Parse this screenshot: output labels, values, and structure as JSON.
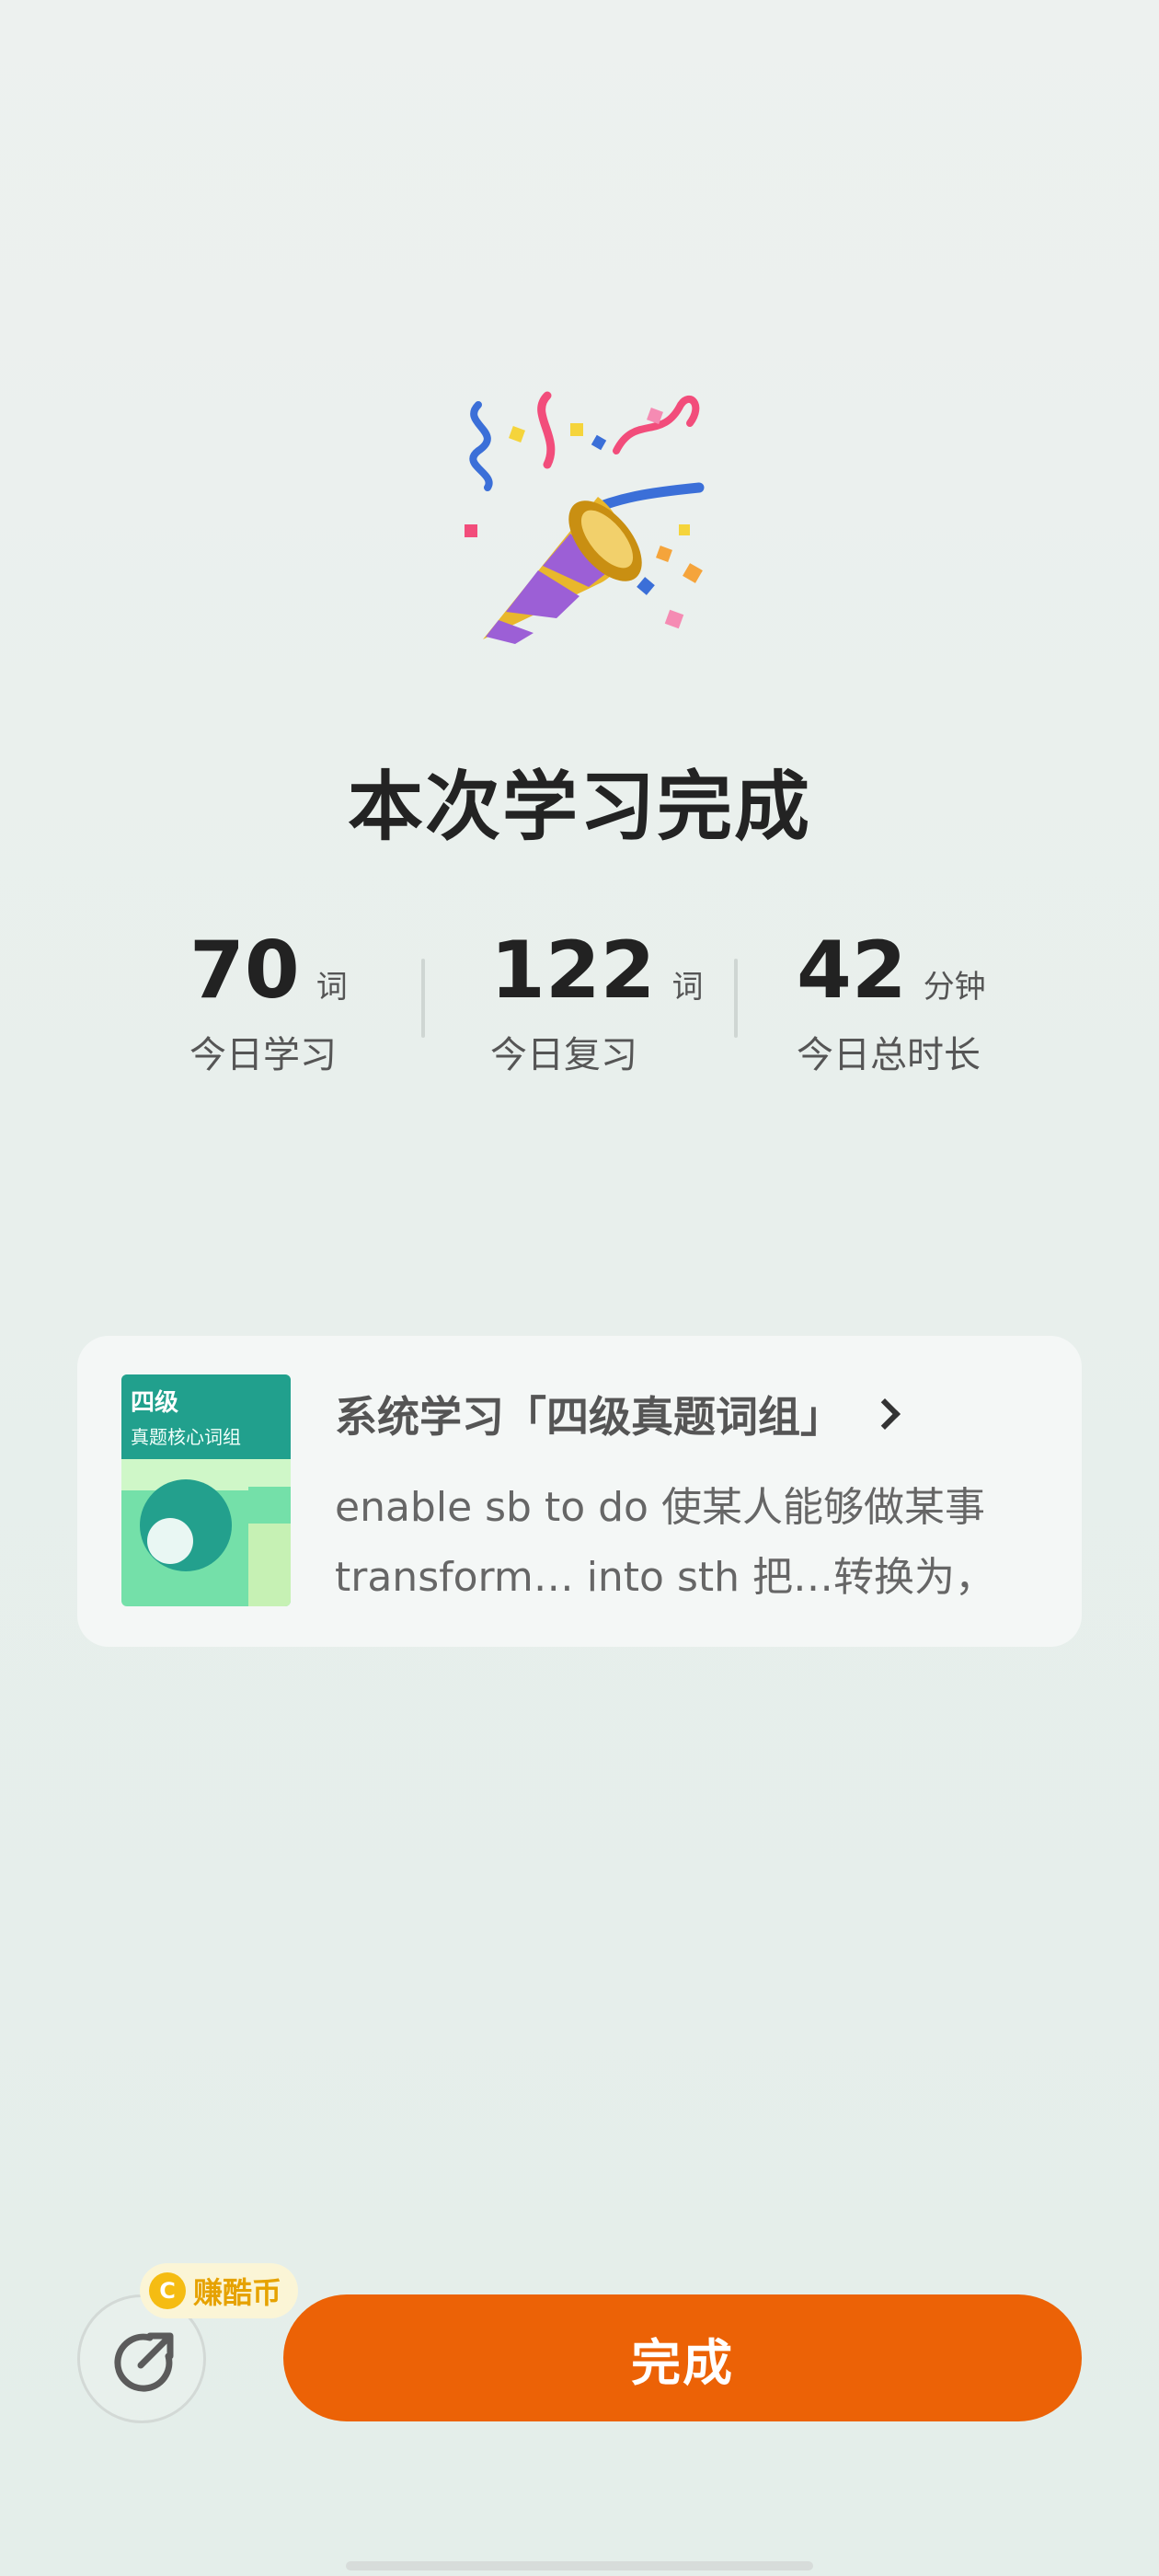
{
  "celebration_icon": "party-popper-icon",
  "title": "本次学习完成",
  "stats": [
    {
      "value": "70",
      "unit": "词",
      "label": "今日学习"
    },
    {
      "value": "122",
      "unit": "词",
      "label": "今日复习"
    },
    {
      "value": "42",
      "unit": "分钟",
      "label": "今日总时长"
    }
  ],
  "book_card": {
    "cover_title": "四级",
    "cover_subtitle": "真题核心词组",
    "title": "系统学习「四级真题词组」",
    "lines": [
      "enable sb to do 使某人能够做某事",
      "transform… into sth 把…转换为，"
    ]
  },
  "bottom": {
    "share_icon": "share-icon",
    "coin_badge": "赚酷币",
    "coin_symbol": "C",
    "done_label": "完成"
  },
  "colors": {
    "accent": "#ec6206",
    "coin": "#f5bc12",
    "cover_green": "#21a08d"
  }
}
